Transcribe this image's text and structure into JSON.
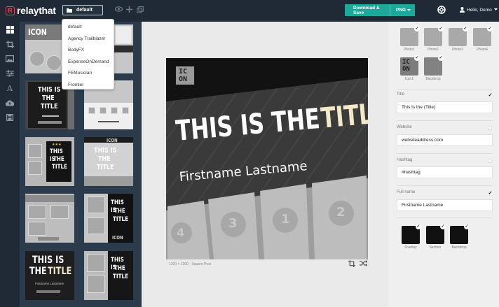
{
  "topbar": {
    "logo_mark": "R",
    "logo_text": "relaythat",
    "folder_value": "default",
    "download_label": "Download & Save",
    "format_value": "PNG",
    "user_label": "Hello, Demo"
  },
  "folder_dropdown": {
    "options": [
      "default",
      "Agency Trailblazer",
      "BodyFX",
      "ExpenseOnDemand",
      "FEMusician",
      "Frontier"
    ]
  },
  "templates": {
    "thumb_title_line1": "THIS IS",
    "thumb_title_line2": "THE",
    "thumb_title_line3": "TITLE",
    "thumb_logo_text": "ICON",
    "thumb_name": "Firstname Lastname"
  },
  "design": {
    "logo_line1": "IC",
    "logo_line2": "ON",
    "title_main": "THIS IS THE",
    "title_accent": "TITLE",
    "name": "Firstname Lastname",
    "numbers": [
      "4",
      "3",
      "1",
      "2"
    ],
    "caption": "1200 × 1200 - Square Post",
    "accent_color": "#f3e8c8",
    "background_color": "#3a3a3a"
  },
  "properties": {
    "images": [
      {
        "label": "Photo1"
      },
      {
        "label": "Photo2"
      },
      {
        "label": "Photo3"
      },
      {
        "label": "Photo4"
      },
      {
        "label": "Icon1"
      },
      {
        "label": "Backdrop"
      }
    ],
    "fields": [
      {
        "label": "Title",
        "value": "This Is the (Title)",
        "checked": true
      },
      {
        "label": "Website",
        "value": "websiteaddress.com",
        "checked": false
      },
      {
        "label": "Hashtag",
        "value": "#hashtag",
        "checked": false
      },
      {
        "label": "Full name",
        "value": "Firstname Lastname",
        "checked": true
      }
    ],
    "colors": [
      {
        "label": "Overlay",
        "color": "#111111"
      },
      {
        "label": "Section",
        "color": "#111111"
      },
      {
        "label": "Backdrop",
        "color": "#111111"
      }
    ]
  }
}
